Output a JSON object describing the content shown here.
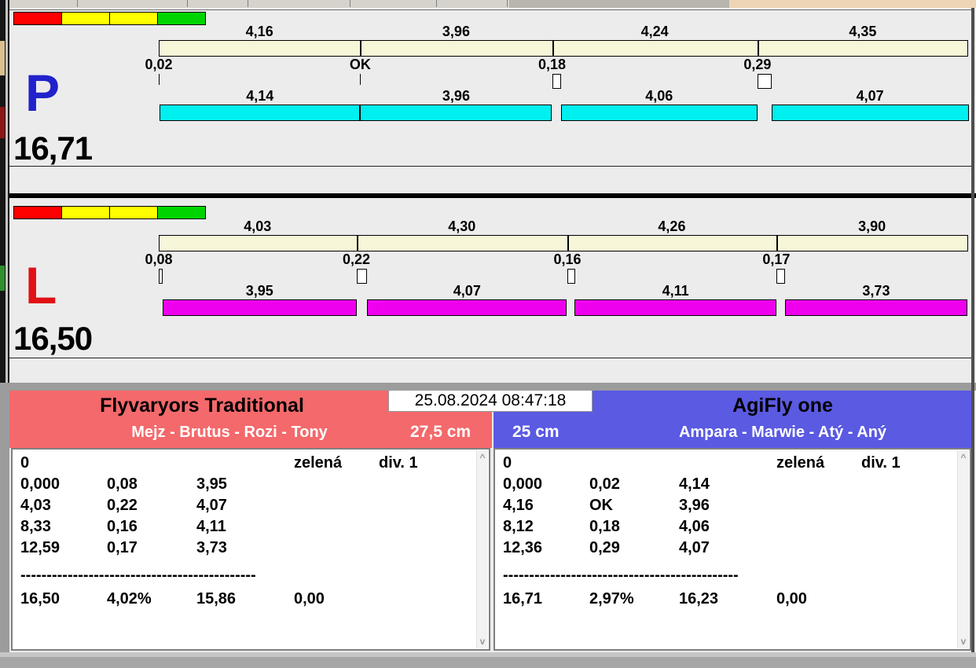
{
  "datetime": "25.08.2024 08:47:18",
  "colors": {
    "split_bar": "#f8f6d8",
    "checkbox": "#ffffff",
    "divider": "#000000",
    "toolbar_tan": "#edd5b5"
  },
  "top_strip": {
    "separators_x": [
      86,
      226,
      303,
      433,
      543,
      633
    ]
  },
  "scrollbar": {
    "up": "^",
    "down": "v"
  },
  "panels": [
    {
      "letter": "P",
      "letter_color": "#2222cc",
      "total_label": "16,71",
      "total_value": 16.71,
      "bar_color": "#00efef",
      "traffic_lights": [
        "#ff0000",
        "#ffff00",
        "#ffff00",
        "#00d400"
      ],
      "top_segments": [
        {
          "label": "4,16",
          "value": 4.16
        },
        {
          "label": "3,96",
          "value": 3.96
        },
        {
          "label": "4,24",
          "value": 4.24
        },
        {
          "label": "4,35",
          "value": 4.35
        }
      ],
      "crossings": [
        {
          "label": "0,02",
          "value": 0.02
        },
        {
          "label": "OK",
          "value": 0
        },
        {
          "label": "0,18",
          "value": 0.18
        },
        {
          "label": "0,29",
          "value": 0.29
        }
      ],
      "runs": [
        {
          "label": "4,14",
          "value": 4.14
        },
        {
          "label": "3,96",
          "value": 3.96
        },
        {
          "label": "4,06",
          "value": 4.06
        },
        {
          "label": "4,07",
          "value": 4.07
        }
      ]
    },
    {
      "letter": "L",
      "letter_color": "#e01015",
      "total_label": "16,50",
      "total_value": 16.5,
      "bar_color": "#ee00ee",
      "traffic_lights": [
        "#ff0000",
        "#ffff00",
        "#ffff00",
        "#00d400"
      ],
      "top_segments": [
        {
          "label": "4,03",
          "value": 4.03
        },
        {
          "label": "4,30",
          "value": 4.3
        },
        {
          "label": "4,26",
          "value": 4.26
        },
        {
          "label": "3,90",
          "value": 3.9
        }
      ],
      "crossings": [
        {
          "label": "0,08",
          "value": 0.08
        },
        {
          "label": "0,22",
          "value": 0.22
        },
        {
          "label": "0,16",
          "value": 0.16
        },
        {
          "label": "0,17",
          "value": 0.17
        }
      ],
      "runs": [
        {
          "label": "3,95",
          "value": 3.95
        },
        {
          "label": "4,07",
          "value": 4.07
        },
        {
          "label": "4,11",
          "value": 4.11
        },
        {
          "label": "3,73",
          "value": 3.73
        }
      ]
    }
  ],
  "teams": [
    {
      "name": "Flyvaryors Traditional",
      "dogs": "Mejz - Brutus - Rozi - Tony",
      "jump_height": "27,5 cm",
      "accent": "#f4696b",
      "rows": [
        [
          "0",
          "",
          "",
          "zelená",
          "div. 1"
        ],
        [
          "0,000",
          "0,08",
          "3,95"
        ],
        [
          "4,03",
          "0,22",
          "4,07"
        ],
        [
          "8,33",
          "0,16",
          "4,11"
        ],
        [
          "12,59",
          "0,17",
          "3,73"
        ]
      ],
      "separator": "---------------------------------------------",
      "totals": [
        "16,50",
        "4,02%",
        "15,86",
        "0,00"
      ]
    },
    {
      "name": "AgiFly one",
      "dogs": "Ampara - Marwie - Atý - Aný",
      "jump_height": "25 cm",
      "accent": "#5a5ae2",
      "rows": [
        [
          "0",
          "",
          "",
          "zelená",
          "div. 1"
        ],
        [
          "0,000",
          "0,02",
          "4,14"
        ],
        [
          "4,16",
          "OK",
          "3,96"
        ],
        [
          "8,12",
          "0,18",
          "4,06"
        ],
        [
          "12,36",
          "0,29",
          "4,07"
        ]
      ],
      "separator": "---------------------------------------------",
      "totals": [
        "16,71",
        "2,97%",
        "16,23",
        "0,00"
      ]
    }
  ]
}
